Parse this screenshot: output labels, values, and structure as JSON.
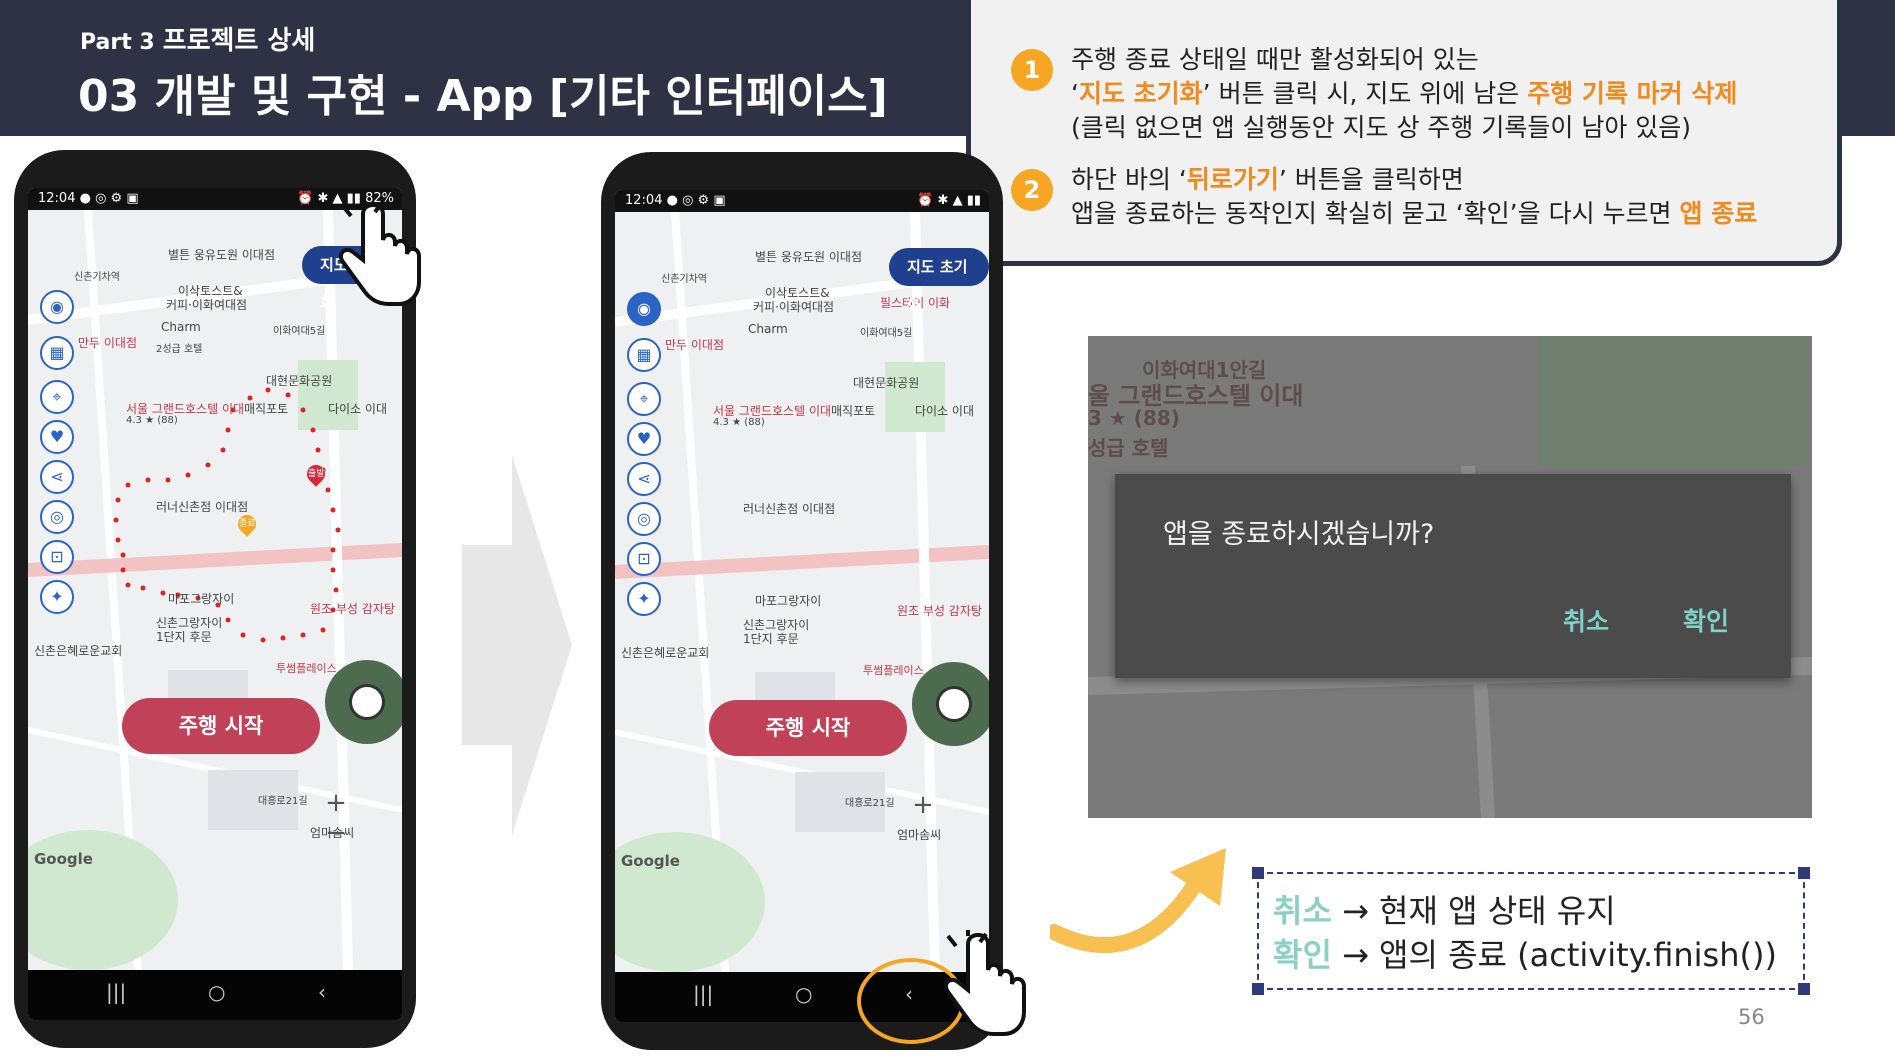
{
  "header": {
    "part_num": "Part 3",
    "part_label": "프로젝트 상세",
    "title": "03 개발 및 구현 - App [기타 인터페이스]"
  },
  "info": {
    "item1": {
      "num": "1",
      "line1": "주행 종료 상태일 때만 활성화되어 있는",
      "line2_pre": "‘",
      "line2_hl1": "지도 초기화",
      "line2_mid": "’ 버튼 클릭 시, 지도 위에 남은 ",
      "line2_hl2": "주행 기록 마커 삭제",
      "line3": "(클릭 없으면 앱 실행동안 지도 상 주행 기록들이 남아 있음)"
    },
    "item2": {
      "num": "2",
      "line1_pre": "하단 바의 ‘",
      "line1_hl": "뒤로가기",
      "line1_post": "’ 버튼을 클릭하면",
      "line2_pre": "앱을 종료하는 동작인지 확실히 묻고 ‘확인’을 다시 누르면 ",
      "line2_hl": "앱 종료"
    }
  },
  "phone1": {
    "time": "12:04",
    "battery": "82%",
    "reset_label": "지도 초기화",
    "start_label": "주행 시작",
    "map_labels": {
      "a": "별튼 웅유도원 이대점",
      "b": "신촌기차역",
      "c": "이삭토스트&",
      "d": "커피·이화여대점",
      "e": "Charm",
      "f": "2성급 호텔",
      "g": "만두 이대점",
      "h": "이화여대5길",
      "i": "대현문화공원",
      "j": "서울 그랜드호스텔 이대",
      "k": "4.3 ★ (88)",
      "l": "매직포토",
      "m": "다이소 이대",
      "n": "러너신촌점 이대점",
      "o": "출발",
      "p": "종료",
      "q": "마포그랑자이",
      "r": "신촌그랑자이",
      "s": "1단지 후문",
      "t": "원조 부성 감자탕",
      "u": "신촌은혜로운교회",
      "v": "투썸플레이스",
      "w": "엄마솜씨",
      "x": "대흥로21길",
      "y": "Google"
    }
  },
  "phone2": {
    "time": "12:04",
    "reset_label": "지도 초기화",
    "start_label": "주행 시작",
    "map_labels": {
      "a": "별튼 웅유도원 이대점",
      "b": "신촌기차역",
      "c": "이삭토스트&",
      "d": "커피·이화여대점",
      "e": "Charm",
      "f": "필스테이 이화",
      "g": "만두 이대점",
      "h": "이화여대5길",
      "i": "대현문화공원",
      "j": "서울 그랜드호스텔 이대",
      "k": "4.3 ★ (88)",
      "l": "매직포토",
      "m": "다이소 이대",
      "n": "러너신촌점 이대점",
      "q": "마포그랑자이",
      "r": "신촌그랑자이",
      "s": "1단지 후문",
      "t": "원조 부성 감자탕",
      "u": "신촌은혜로운교회",
      "v": "투썸플레이스",
      "w": "엄마솜씨",
      "x": "대흥로21길",
      "y": "Google"
    }
  },
  "dialog": {
    "bg1": "이화여대1안길",
    "bg2": "울 그랜드호스텔 이대",
    "bg3": "3 ★ (88)",
    "bg4": "성급 호텔",
    "question": "앱을 종료하시겠습니까?",
    "cancel": "취소",
    "confirm": "확인"
  },
  "legend": {
    "row1_key": "취소",
    "row1_text": " → 현재 앱 상태 유지",
    "row2_key": "확인",
    "row2_text": " → 앱의 종료 (activity.finish())"
  },
  "page_number": "56",
  "colors": {
    "header_bg": "#2f3145",
    "accent_orange": "#f08a1c",
    "badge_orange": "#f5a623",
    "teal": "#8ccfc4",
    "start_button": "#c14159",
    "reset_button": "#1f3f8f"
  }
}
